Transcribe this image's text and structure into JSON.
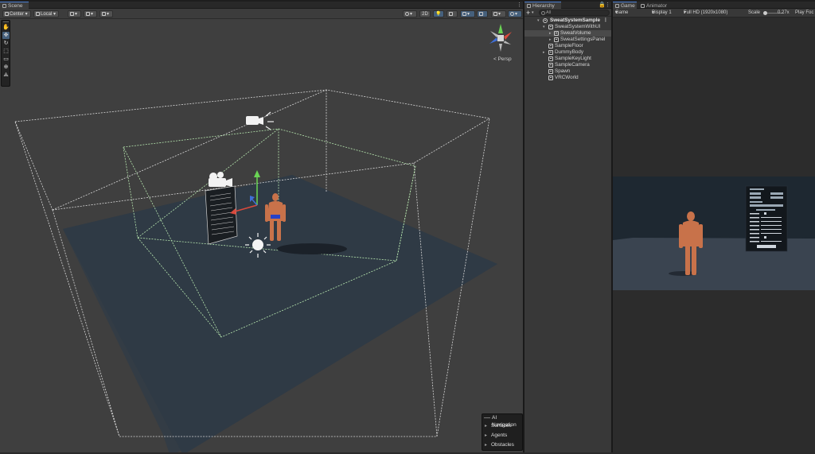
{
  "scene": {
    "tab_label": "Scene",
    "toolbar": {
      "pivot_label": "Center",
      "space_label": "Local",
      "mode_2d_label": "2D"
    },
    "view_label": "< Persp",
    "ai_navigation": {
      "title": "AI Navigation",
      "items": [
        "Surfaces",
        "Agents",
        "Obstacles"
      ]
    }
  },
  "hierarchy": {
    "tab_label": "Hierarchy",
    "add_label": "+",
    "search_placeholder": "All",
    "scene_name": "SweatSystemSample",
    "items": [
      {
        "label": "SweatSystemWithUI"
      },
      {
        "label": "SweatVolume"
      },
      {
        "label": "SweatSettingsPanel"
      },
      {
        "label": "SampleFloor"
      },
      {
        "label": "DummyBody"
      },
      {
        "label": "SampleKeyLight"
      },
      {
        "label": "SampleCamera"
      },
      {
        "label": "Spawn"
      },
      {
        "label": "VRCWorld"
      }
    ]
  },
  "game": {
    "tab_label": "Game",
    "animator_tab_label": "Animator",
    "mode_label": "Game",
    "display_label": "Display 1",
    "resolution_label": "Full HD (1920x1080)",
    "scale_label": "Scale",
    "scale_value": "0.27x",
    "play_focus_label": "Play Foc"
  },
  "colors": {
    "accent": "#4b7fd1",
    "selection": "#46607c",
    "volume_green": "#b8e8b0",
    "floor": "#2f3a45",
    "avatar": "#c8724a"
  },
  "icons": {
    "scene_tab": "scene-grid-icon",
    "hierarchy_tab": "hierarchy-list-icon",
    "game_tab": "gamepad-icon",
    "animator_tab": "animator-icon",
    "camera": "camera-icon",
    "light": "sun-light-icon"
  }
}
